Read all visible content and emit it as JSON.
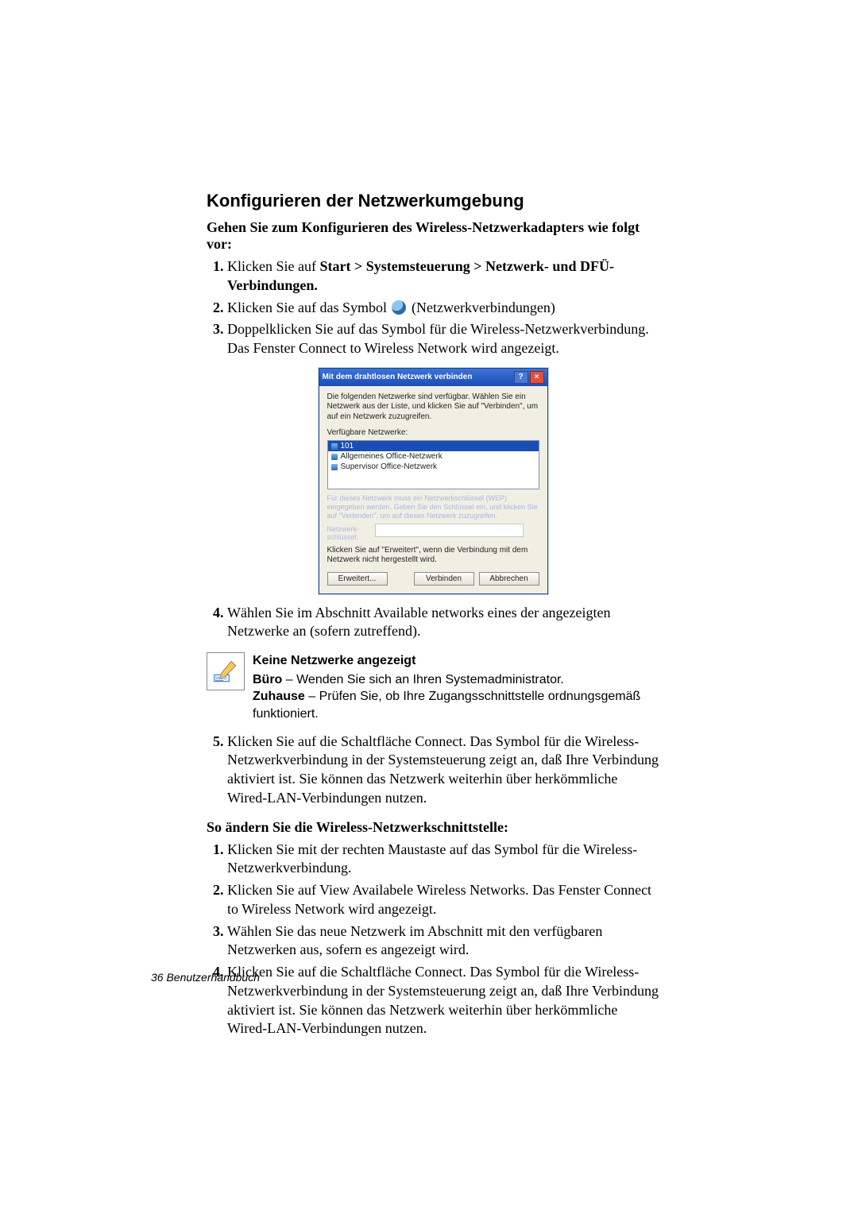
{
  "section_title": "Konfigurieren der Netzwerkumgebung",
  "intro_line": "Gehen Sie zum Konfigurieren des Wireless-Netzwerkadapters wie folgt vor:",
  "list1": {
    "i1_pre": "Klicken Sie auf ",
    "i1_bold": "Start > Systemsteuerung > Netzwerk- und DFÜ-Verbindungen.",
    "i2_pre": "Klicken Sie auf das Symbol ",
    "i2_post": " (Netzwerkverbindungen)",
    "i3": "Doppelklicken Sie auf das Symbol für die Wireless-Netzwerkverbindung. Das Fenster Connect to Wireless Network wird angezeigt.",
    "i4": "Wählen Sie im Abschnitt Available networks eines der angezeigten Netzwerke an (sofern zutreffend)."
  },
  "dialog": {
    "title": "Mit dem drahtlosen Netzwerk verbinden",
    "instr": "Die folgenden Netzwerke sind verfügbar. Wählen Sie ein Netzwerk aus der Liste, und klicken Sie auf \"Verbinden\", um auf ein Netzwerk zuzugreifen.",
    "avail_label": "Verfügbare Netzwerke:",
    "net1": "101",
    "net2": "Allgemeines Office-Netzwerk",
    "net3": "Supervisor Office-Netzwerk",
    "blur1": "Für dieses Netzwerk muss ein Netzwerkschlüssel (WEP) eingegeben werden. Geben Sie den Schlüssel ein, und klicken Sie auf \"Verbinden\", um auf dieses Netzwerk zuzugreifen.",
    "blur_label": "Netzwerk-schlüssel:",
    "note2": "Klicken Sie auf \"Erweitert\", wenn die Verbindung mit dem Netzwerk nicht hergestellt wird.",
    "btn_adv": "Erweitert...",
    "btn_connect": "Verbinden",
    "btn_cancel": "Abbrechen"
  },
  "note": {
    "title": "Keine Netzwerke angezeigt",
    "buro_b": "Büro",
    "buro_rest": " – Wenden Sie sich an Ihren Systemadministrator.",
    "zu_b": "Zuhause",
    "zu_rest": " – Prüfen Sie, ob Ihre Zugangsschnittstelle ordnungsgemäß funktioniert."
  },
  "list1_cont": {
    "i5": "Klicken Sie auf die Schaltfläche Connect. Das Symbol für die Wireless-Netzwerkverbindung in der Systemsteuerung zeigt an, daß Ihre Verbindung aktiviert ist. Sie können das Netzwerk weiterhin über herkömmliche Wired-LAN-Verbindungen nutzen."
  },
  "sub_head": "So ändern Sie die Wireless-Netzwerkschnittstelle:",
  "list2": {
    "i1": "Klicken Sie mit der rechten Maustaste auf das Symbol für die Wireless-Netzwerkverbindung.",
    "i2": "Klicken Sie auf View Availabele Wireless Networks. Das Fenster Connect to Wireless Network wird angezeigt.",
    "i3": "Wählen Sie das neue Netzwerk im Abschnitt mit den verfügbaren Netzwerken aus, sofern es angezeigt wird.",
    "i4": "Klicken Sie auf die Schaltfläche Connect. Das Symbol für die Wireless-Netzwerkverbindung in der Systemsteuerung zeigt an, daß Ihre Verbindung aktiviert ist. Sie können das Netzwerk weiterhin über herkömmliche Wired-LAN-Verbindungen nutzen."
  },
  "footer": "36  Benutzerhandbuch"
}
